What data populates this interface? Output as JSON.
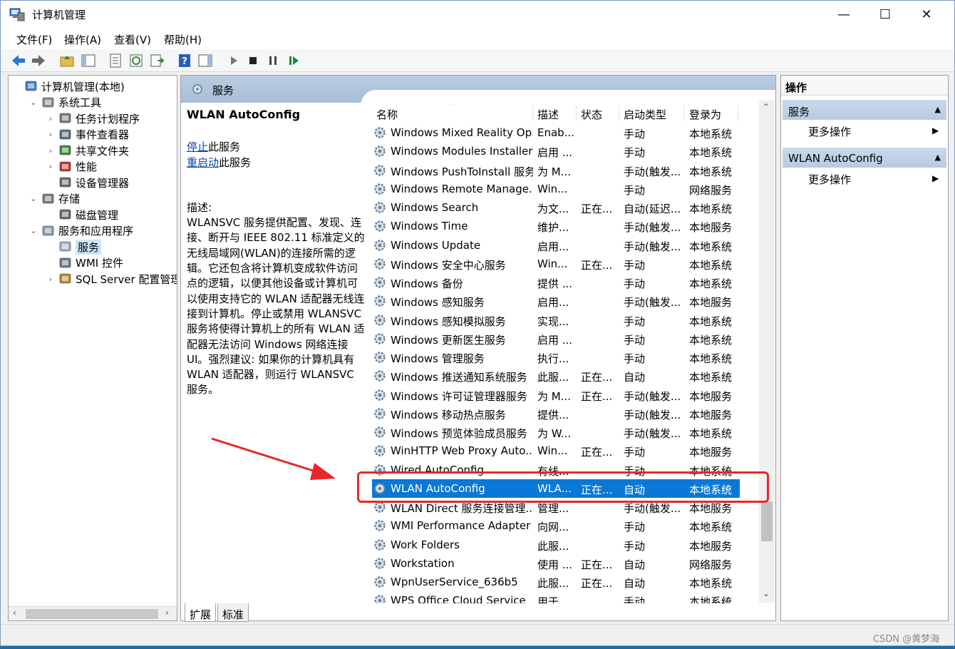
{
  "window": {
    "title": "计算机管理",
    "minimize": "—",
    "maximize": "☐",
    "close": "✕"
  },
  "menu": [
    "文件(F)",
    "操作(A)",
    "查看(V)",
    "帮助(H)"
  ],
  "tree": [
    {
      "label": "计算机管理(本地)",
      "level": 0,
      "chev": "",
      "icon": "computer-management-icon"
    },
    {
      "label": "系统工具",
      "level": 1,
      "chev": "⌄",
      "icon": "system-tools-icon"
    },
    {
      "label": "任务计划程序",
      "level": 2,
      "chev": "›",
      "icon": "task-scheduler-icon"
    },
    {
      "label": "事件查看器",
      "level": 2,
      "chev": "›",
      "icon": "event-viewer-icon"
    },
    {
      "label": "共享文件夹",
      "level": 2,
      "chev": "›",
      "icon": "shared-folders-icon"
    },
    {
      "label": "性能",
      "level": 2,
      "chev": "›",
      "icon": "performance-icon"
    },
    {
      "label": "设备管理器",
      "level": 2,
      "chev": "",
      "icon": "device-manager-icon"
    },
    {
      "label": "存储",
      "level": 1,
      "chev": "⌄",
      "icon": "storage-icon"
    },
    {
      "label": "磁盘管理",
      "level": 2,
      "chev": "",
      "icon": "disk-management-icon"
    },
    {
      "label": "服务和应用程序",
      "level": 1,
      "chev": "⌄",
      "icon": "services-apps-icon"
    },
    {
      "label": "服务",
      "level": 2,
      "chev": "",
      "icon": "services-icon",
      "selected": true
    },
    {
      "label": "WMI 控件",
      "level": 2,
      "chev": "",
      "icon": "wmi-icon"
    },
    {
      "label": "SQL Server 配置管理器",
      "level": 2,
      "chev": "›",
      "icon": "sql-server-icon"
    }
  ],
  "center": {
    "header": "服务",
    "description": {
      "title": "WLAN AutoConfig",
      "stop_link": "停止",
      "stop_rest": "此服务",
      "restart_link": "重启动",
      "restart_rest": "此服务",
      "label": "描述:",
      "text": "WLANSVC 服务提供配置、发现、连接、断开与 IEEE 802.11 标准定义的无线局域网(WLAN)的连接所需的逻辑。它还包含将计算机变成软件访问点的逻辑，以便其他设备或计算机可以使用支持它的 WLAN 适配器无线连接到计算机。停止或禁用 WLANSVC 服务将使得计算机上的所有 WLAN 适配器无法访问 Windows 网络连接 UI。强烈建议: 如果你的计算机具有 WLAN 适配器，则运行 WLANSVC 服务。"
    },
    "columns": [
      "名称",
      "描述",
      "状态",
      "启动类型",
      "登录为"
    ],
    "rows": [
      {
        "name": "Windows Mixed Reality Op...",
        "desc": "Enab...",
        "status": "",
        "startup": "手动",
        "logon": "本地系统"
      },
      {
        "name": "Windows Modules Installer",
        "desc": "启用 ...",
        "status": "",
        "startup": "手动",
        "logon": "本地系统"
      },
      {
        "name": "Windows PushToInstall 服务",
        "desc": "为 M...",
        "status": "",
        "startup": "手动(触发...",
        "logon": "本地系统"
      },
      {
        "name": "Windows Remote Manage...",
        "desc": "Win...",
        "status": "",
        "startup": "手动",
        "logon": "网络服务"
      },
      {
        "name": "Windows Search",
        "desc": "为文...",
        "status": "正在...",
        "startup": "自动(延迟...",
        "logon": "本地系统"
      },
      {
        "name": "Windows Time",
        "desc": "维护...",
        "status": "",
        "startup": "手动(触发...",
        "logon": "本地服务"
      },
      {
        "name": "Windows Update",
        "desc": "启用...",
        "status": "",
        "startup": "手动(触发...",
        "logon": "本地系统"
      },
      {
        "name": "Windows 安全中心服务",
        "desc": "Win...",
        "status": "正在...",
        "startup": "手动",
        "logon": "本地系统"
      },
      {
        "name": "Windows 备份",
        "desc": "提供 ...",
        "status": "",
        "startup": "手动",
        "logon": "本地系统"
      },
      {
        "name": "Windows 感知服务",
        "desc": "启用...",
        "status": "",
        "startup": "手动(触发...",
        "logon": "本地服务"
      },
      {
        "name": "Windows 感知模拟服务",
        "desc": "实现...",
        "status": "",
        "startup": "手动",
        "logon": "本地系统"
      },
      {
        "name": "Windows 更新医生服务",
        "desc": "启用 ...",
        "status": "",
        "startup": "手动",
        "logon": "本地系统"
      },
      {
        "name": "Windows 管理服务",
        "desc": "执行...",
        "status": "",
        "startup": "手动",
        "logon": "本地系统"
      },
      {
        "name": "Windows 推送通知系统服务",
        "desc": "此服...",
        "status": "正在...",
        "startup": "自动",
        "logon": "本地系统"
      },
      {
        "name": "Windows 许可证管理器服务",
        "desc": "为 M...",
        "status": "正在...",
        "startup": "手动(触发...",
        "logon": "本地服务"
      },
      {
        "name": "Windows 移动热点服务",
        "desc": "提供...",
        "status": "",
        "startup": "手动(触发...",
        "logon": "本地服务"
      },
      {
        "name": "Windows 预览体验成员服务",
        "desc": "为 W...",
        "status": "",
        "startup": "手动(触发...",
        "logon": "本地系统"
      },
      {
        "name": "WinHTTP Web Proxy Auto...",
        "desc": "Win...",
        "status": "正在...",
        "startup": "手动",
        "logon": "本地服务"
      },
      {
        "name": "Wired AutoConfig",
        "desc": "有线...",
        "status": "",
        "startup": "手动",
        "logon": "本地系统"
      },
      {
        "name": "WLAN AutoConfig",
        "desc": "WLA...",
        "status": "正在...",
        "startup": "自动",
        "logon": "本地系统",
        "selected": true
      },
      {
        "name": "WLAN Direct 服务连接管理...",
        "desc": "管理...",
        "status": "",
        "startup": "手动(触发...",
        "logon": "本地服务"
      },
      {
        "name": "WMI Performance Adapter",
        "desc": "向网...",
        "status": "",
        "startup": "手动",
        "logon": "本地系统"
      },
      {
        "name": "Work Folders",
        "desc": "此服...",
        "status": "",
        "startup": "手动",
        "logon": "本地服务"
      },
      {
        "name": "Workstation",
        "desc": "使用 ...",
        "status": "正在...",
        "startup": "自动",
        "logon": "网络服务"
      },
      {
        "name": "WpnUserService_636b5",
        "desc": "此服...",
        "status": "正在...",
        "startup": "自动",
        "logon": "本地系统"
      },
      {
        "name": "WPS Office Cloud Service",
        "desc": "用于...",
        "status": "",
        "startup": "手动",
        "logon": "本地系统"
      }
    ],
    "tabs": [
      "扩展",
      "标准"
    ]
  },
  "actions": {
    "title": "操作",
    "groups": [
      {
        "label": "服务",
        "item": "更多操作"
      },
      {
        "label": "WLAN AutoConfig",
        "item": "更多操作"
      }
    ]
  },
  "watermark": "CSDN @黄梦海",
  "colors": {
    "selection": "#0a78d7",
    "highlight_box": "#e8262a",
    "annotation_arrow": "#e8262a"
  }
}
